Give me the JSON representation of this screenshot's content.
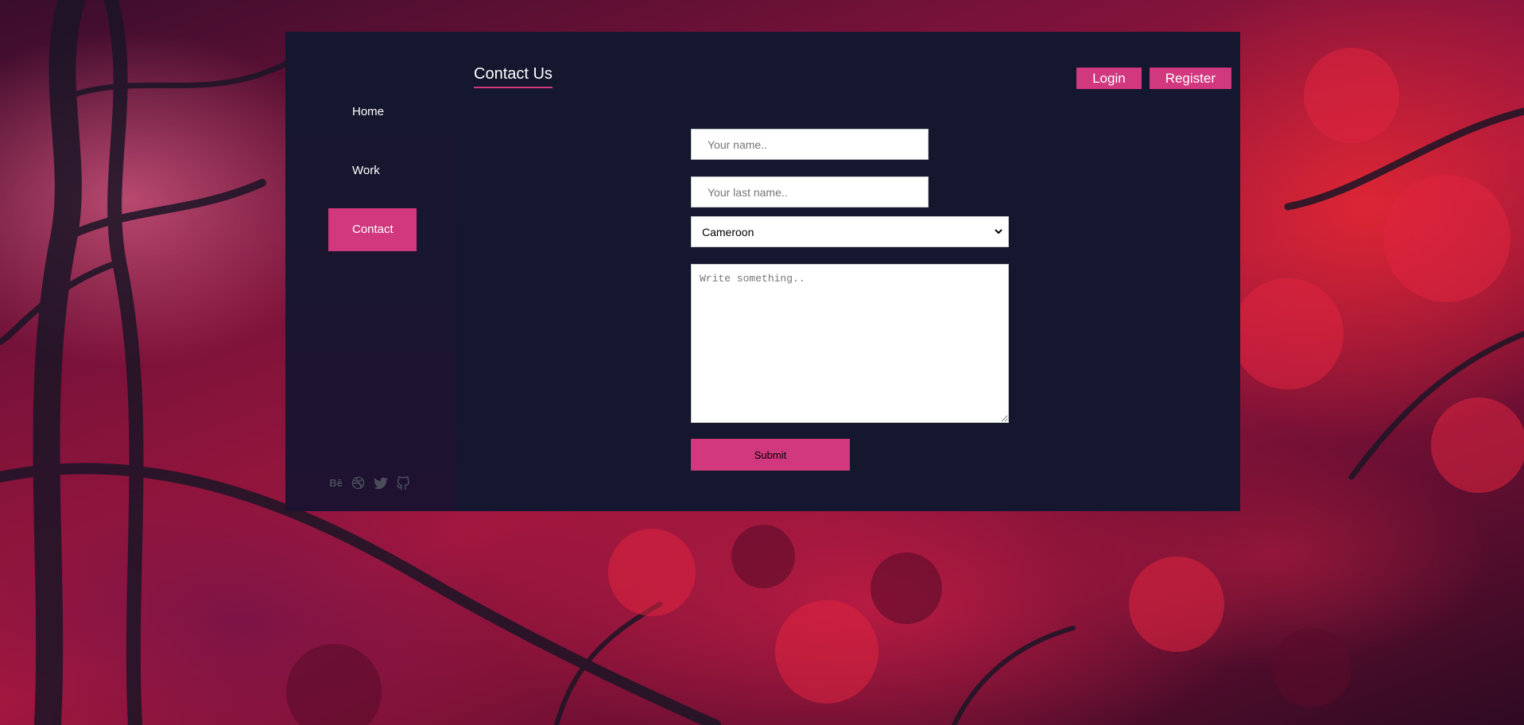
{
  "colors": {
    "accent": "#d1387e",
    "panel": "#14172d",
    "text": "#ffffff"
  },
  "sidebar": {
    "items": [
      {
        "label": "Home"
      },
      {
        "label": "Work"
      },
      {
        "label": "Contact"
      }
    ],
    "active": "Contact",
    "social": [
      {
        "icon": "behance-icon",
        "glyph": "Bē"
      },
      {
        "icon": "dribbble-icon",
        "glyph": ""
      },
      {
        "icon": "twitter-icon",
        "glyph": ""
      },
      {
        "icon": "github-icon",
        "glyph": ""
      }
    ]
  },
  "header": {
    "title": "Contact Us",
    "login_label": "Login",
    "register_label": "Register"
  },
  "form": {
    "first_name_placeholder": "Your name..",
    "last_name_placeholder": "Your last name..",
    "country_value": "Cameroon",
    "message_placeholder": "Write something..",
    "submit_label": "Submit"
  }
}
